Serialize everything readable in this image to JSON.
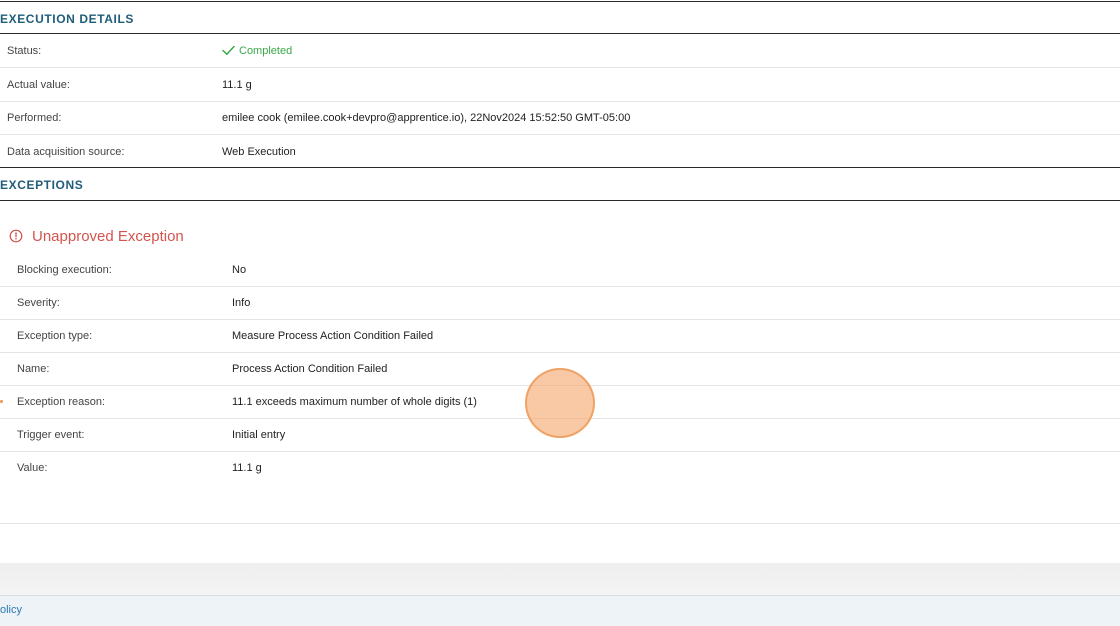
{
  "execution_details": {
    "header": "EXECUTION DETAILS",
    "rows": [
      {
        "label": "Status:",
        "value": "Completed"
      },
      {
        "label": "Actual value:",
        "value": "11.1 g"
      },
      {
        "label": "Performed:",
        "value": "emilee cook (emilee.cook+devpro@apprentice.io), 22Nov2024 15:52:50 GMT-05:00"
      },
      {
        "label": "Data acquisition source:",
        "value": "Web Execution"
      }
    ]
  },
  "exceptions": {
    "header": "EXCEPTIONS",
    "title": "Unapproved Exception",
    "rows": [
      {
        "label": "Blocking execution:",
        "value": "No"
      },
      {
        "label": "Severity:",
        "value": "Info"
      },
      {
        "label": "Exception type:",
        "value": "Measure Process Action Condition Failed"
      },
      {
        "label": "Name:",
        "value": "Process Action Condition Failed"
      },
      {
        "label": "Exception reason:",
        "value": "11.1 exceeds maximum number of whole digits (1)"
      },
      {
        "label": "Trigger event:",
        "value": "Initial entry"
      },
      {
        "label": "Value:",
        "value": "11.1 g"
      }
    ]
  },
  "footer": {
    "link_text": "olicy"
  },
  "colors": {
    "section_header": "#1f5d7a",
    "status_completed": "#3aa84a",
    "exception_title": "#d4544e",
    "footer_link": "#2a7ab0",
    "cursor_highlight": "#f4a86c"
  },
  "icons": {
    "status": "check-icon",
    "exception": "alert-circle-icon"
  }
}
